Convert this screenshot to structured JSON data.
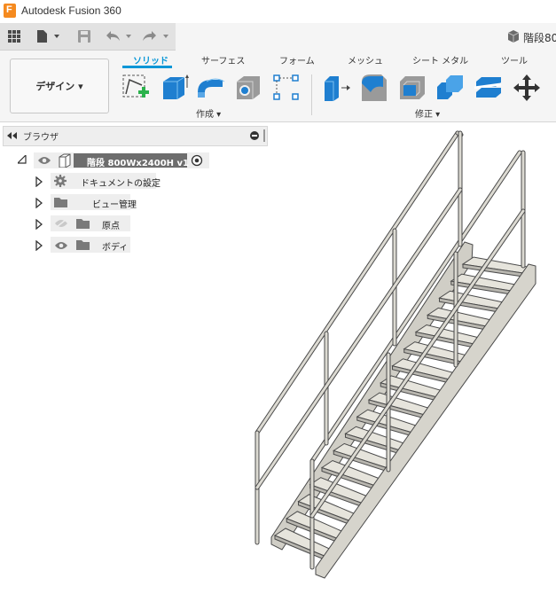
{
  "app": {
    "title": "Autodesk Fusion 360",
    "logo_letter": "F"
  },
  "document_tab": {
    "label": "階段80"
  },
  "ribbon": {
    "workspace": "デザイン ▾",
    "tabs": [
      "ソリッド",
      "サーフェス",
      "フォーム",
      "メッシュ",
      "シート メタル",
      "ツール"
    ],
    "active_tab": "ソリッド",
    "groups": {
      "create": "作成 ▾",
      "modify": "修正 ▾"
    }
  },
  "browser": {
    "title": "ブラウザ",
    "root": {
      "label": "階段 800Wx2400H v1"
    },
    "items": [
      {
        "label": "ドキュメントの設定"
      },
      {
        "label": "ビュー管理"
      },
      {
        "label": "原点"
      },
      {
        "label": "ボディ"
      }
    ]
  },
  "colors": {
    "accent": "#0696d7",
    "logo": "#f58a1f",
    "model": "#dcdad2",
    "model_edge": "#4a4a4a"
  }
}
